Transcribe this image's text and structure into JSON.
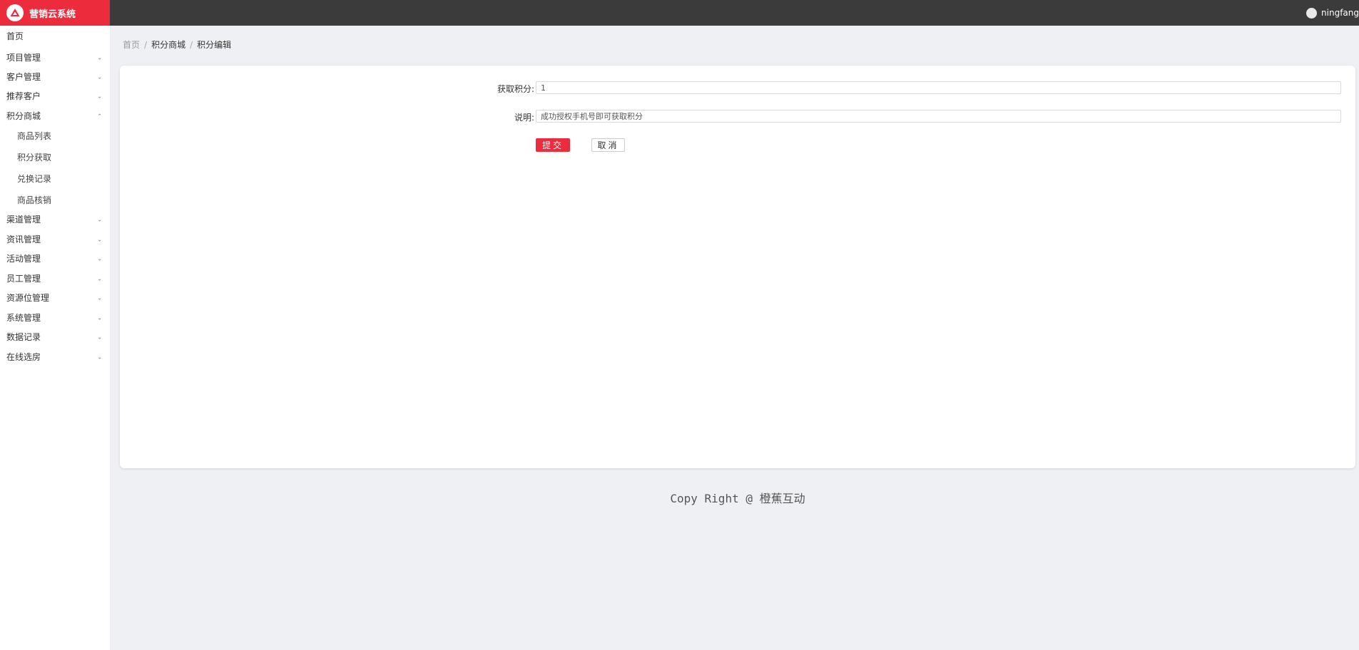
{
  "app": {
    "title": "营销云系统"
  },
  "user": {
    "name": "ningfang"
  },
  "sidebar": {
    "items": [
      {
        "label": "首页",
        "has_children": false
      },
      {
        "label": "项目管理",
        "has_children": true,
        "expanded": false
      },
      {
        "label": "客户管理",
        "has_children": true,
        "expanded": false
      },
      {
        "label": "推荐客户",
        "has_children": true,
        "expanded": false
      },
      {
        "label": "积分商城",
        "has_children": true,
        "expanded": true
      },
      {
        "label": "商品列表",
        "sub": true
      },
      {
        "label": "积分获取",
        "sub": true
      },
      {
        "label": "兑换记录",
        "sub": true
      },
      {
        "label": "商品核销",
        "sub": true
      },
      {
        "label": "渠道管理",
        "has_children": true,
        "expanded": false
      },
      {
        "label": "资讯管理",
        "has_children": true,
        "expanded": false
      },
      {
        "label": "活动管理",
        "has_children": true,
        "expanded": false
      },
      {
        "label": "员工管理",
        "has_children": true,
        "expanded": false
      },
      {
        "label": "资源位管理",
        "has_children": true,
        "expanded": false
      },
      {
        "label": "系统管理",
        "has_children": true,
        "expanded": false
      },
      {
        "label": "数据记录",
        "has_children": true,
        "expanded": false
      },
      {
        "label": "在线选房",
        "has_children": true,
        "expanded": false
      }
    ]
  },
  "breadcrumb": {
    "home": "首页",
    "section": "积分商城",
    "current": "积分编辑",
    "separator": "/"
  },
  "form": {
    "points_label": "获取积分:",
    "points_value": "1",
    "desc_label": "说明:",
    "desc_value": "成功授权手机号即可获取积分",
    "submit_label": "提交",
    "cancel_label": "取消"
  },
  "footer": {
    "text": "Copy Right @ 橙蕉互动"
  },
  "colors": {
    "brand": "#ec2b3c",
    "topbar": "#3a3b3a",
    "background": "#eff0f3"
  },
  "icons": {
    "logo": "brand-logo-icon",
    "avatar": "user-avatar-icon",
    "expand": "chevron-down-icon",
    "collapse": "chevron-up-icon"
  }
}
